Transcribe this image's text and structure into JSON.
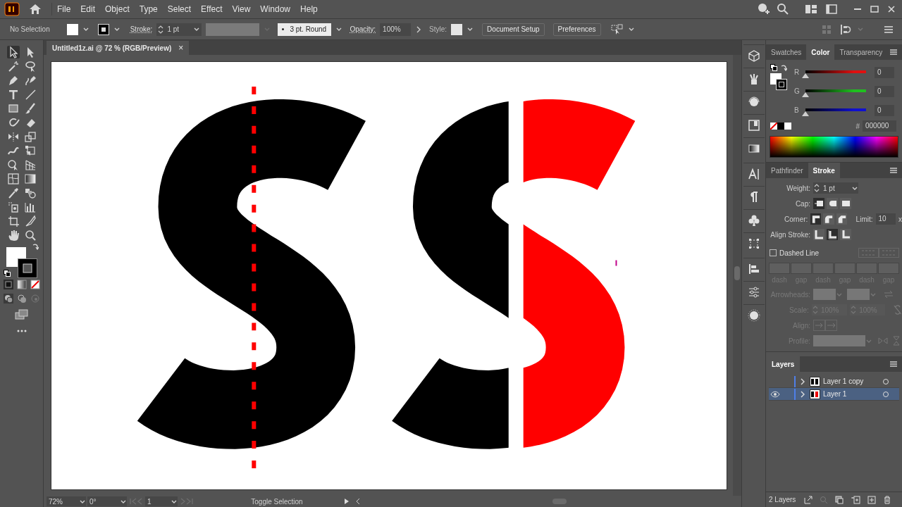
{
  "menu": [
    "File",
    "Edit",
    "Object",
    "Type",
    "Select",
    "Effect",
    "View",
    "Window",
    "Help"
  ],
  "control_bar": {
    "selection": "No Selection",
    "stroke_label": "Stroke:",
    "stroke_weight": "1 pt",
    "brush": "3 pt. Round",
    "opacity_label": "Opacity:",
    "opacity": "100%",
    "style_label": "Style:",
    "buttons": [
      "Document Setup",
      "Preferences"
    ]
  },
  "document_tab": {
    "title": "Untitled1z.ai @ 72 % (RGB/Preview)",
    "close": "×"
  },
  "color_panel": {
    "tabs": [
      {
        "label": "Swatches",
        "selected": false
      },
      {
        "label": "Color",
        "selected": true
      },
      {
        "label": "Transparency",
        "selected": false
      }
    ],
    "channels": [
      {
        "label": "R",
        "value": "0",
        "level": 0,
        "color": "#e01010"
      },
      {
        "label": "G",
        "value": "0",
        "level": 0,
        "color": "#20c020"
      },
      {
        "label": "B",
        "value": "0",
        "level": 0,
        "color": "#1010d0"
      }
    ],
    "hex_label": "#",
    "hex": "000000"
  },
  "stroke_panel": {
    "tabs": [
      {
        "label": "Pathfinder",
        "selected": false
      },
      {
        "label": "Stroke",
        "selected": true
      }
    ],
    "weight_label": "Weight:",
    "weight": "1 pt",
    "cap_label": "Cap:",
    "caps": [
      {
        "selected": true
      },
      {
        "selected": false
      },
      {
        "selected": false
      }
    ],
    "corner_label": "Corner:",
    "corners": [
      {
        "selected": true
      },
      {
        "selected": false
      },
      {
        "selected": false
      }
    ],
    "limit_label": "Limit:",
    "limit": "10",
    "limit_unit": "x",
    "align_label": "Align Stroke:",
    "aligns": [
      {
        "selected": false
      },
      {
        "selected": true
      },
      {
        "selected": false
      }
    ],
    "dashed_line": {
      "label": "Dashed Line",
      "checked": false
    },
    "dash_labels": [
      "dash",
      "gap",
      "dash",
      "gap",
      "dash",
      "gap"
    ],
    "arrowheads_label": "Arrowheads:",
    "scale_label": "Scale:",
    "scales": [
      "100%",
      "100%"
    ],
    "arrow_align_label": "Align:",
    "profile_label": "Profile:"
  },
  "layers_panel": {
    "title": "Layers",
    "layers": [
      {
        "name": "Layer 1 copy",
        "visible": false,
        "selected": false
      },
      {
        "name": "Layer 1",
        "visible": true,
        "selected": true
      }
    ],
    "count": "2 Layers"
  },
  "status_bar": {
    "zoom": "72%",
    "rotation": "0°",
    "artboard": "1",
    "tool": "Toggle Selection"
  }
}
